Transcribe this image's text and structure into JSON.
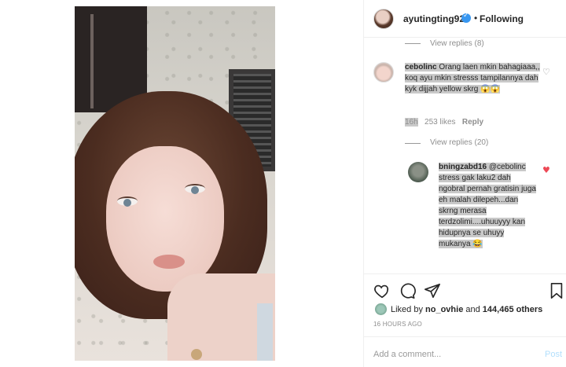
{
  "header": {
    "username": "ayutingting92",
    "separator": "•",
    "follow_status": "Following"
  },
  "comments": {
    "view_replies_top": "View replies (8)",
    "c1": {
      "username": "cebolinc",
      "text": "Orang laen mkin bahagiaaa,, koq ayu mkin stresss tampilannya dah kyk dijjah yellow skrg",
      "emoji": "😱😱",
      "time": "16h",
      "likes": "253 likes",
      "reply": "Reply"
    },
    "view_replies_c1": "View replies (20)",
    "r1": {
      "username": "bningzabd16",
      "mention": "@cebolinc",
      "text": "stress gak laku2 dah ngobral pernah gratisin juga eh malah dilepeh...dan skrng merasa terdzolimi....uhuuyyy kan hidupnya se uhuyy mukanya",
      "emoji": "😂"
    }
  },
  "likes": {
    "prefix": "Liked by ",
    "user": "no_ovhie",
    "middle": " and ",
    "count": "144,465 others"
  },
  "timestamp": "16 HOURS AGO",
  "add_comment": {
    "placeholder": "Add a comment...",
    "post_label": "Post"
  },
  "icons": {
    "verified": "verified-badge-icon",
    "heart": "heart-icon",
    "comment": "comment-icon",
    "share": "paper-plane-icon",
    "save": "bookmark-icon"
  },
  "colors": {
    "link": "#3897f0",
    "liked_heart": "#ed4956",
    "muted": "#8e8e8e",
    "post_disabled": "#b2dffc"
  }
}
